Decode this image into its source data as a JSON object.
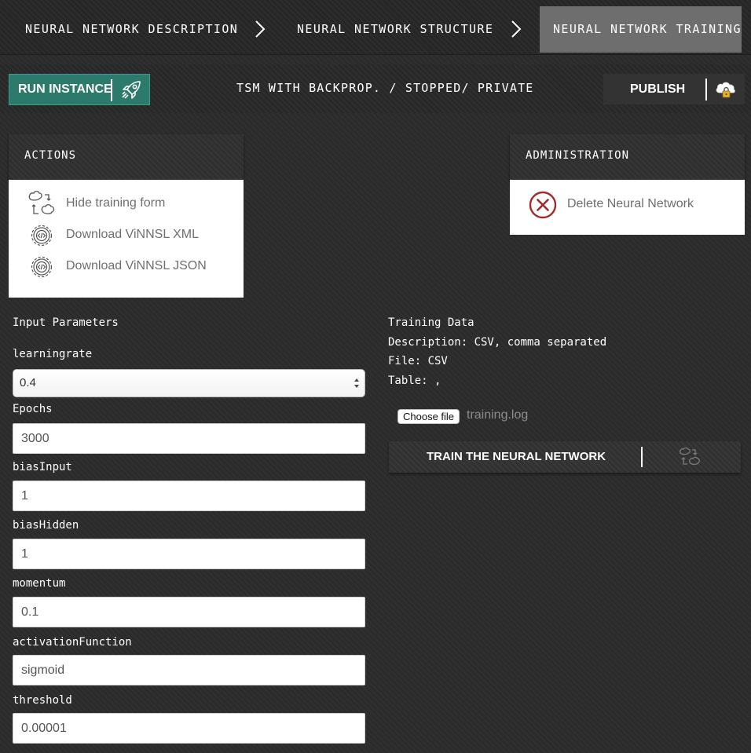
{
  "breadcrumb": {
    "steps": [
      {
        "label": "NEURAL NETWORK DESCRIPTION"
      },
      {
        "label": "NEURAL NETWORK STRUCTURE"
      },
      {
        "label": "NEURAL NETWORK TRAINING"
      }
    ]
  },
  "toolbar": {
    "run_label": "RUN INSTANCE",
    "status": "TSM WITH BACKPROP. / STOPPED/ PRIVATE",
    "publish_label": "PUBLISH"
  },
  "actions": {
    "title": "ACTIONS",
    "items": [
      {
        "label": "Hide training form",
        "icon": "hide-form-icon"
      },
      {
        "label": "Download ViNNSL XML",
        "icon": "gear-code-icon"
      },
      {
        "label": "Download ViNNSL JSON",
        "icon": "gear-code-icon"
      }
    ]
  },
  "administration": {
    "title": "ADMINISTRATION",
    "delete_label": "Delete Neural Network",
    "delete_color": "#a3292b"
  },
  "input_parameters": {
    "title": "Input Parameters",
    "learningrate": {
      "label": "learningrate",
      "value": "0.4"
    },
    "epochs": {
      "label": "Epochs",
      "value": "3000"
    },
    "biasInput": {
      "label": "biasInput",
      "value": "1"
    },
    "biasHidden": {
      "label": "biasHidden",
      "value": "1"
    },
    "momentum": {
      "label": "momentum",
      "value": "0.1"
    },
    "activationFunction": {
      "label": "activationFunction",
      "value": "sigmoid"
    },
    "threshold": {
      "label": "threshold",
      "value": "0.00001"
    }
  },
  "training_data": {
    "title": "Training Data",
    "description": "Description: CSV, comma separated",
    "file": "File: CSV",
    "table": "Table: ,",
    "choose_file_label": "Choose file",
    "file_name": "training.log",
    "train_label": "TRAIN THE NEURAL NETWORK"
  },
  "colors": {
    "accent": "#2c7a6c",
    "active_step": "#6e6e6e"
  }
}
